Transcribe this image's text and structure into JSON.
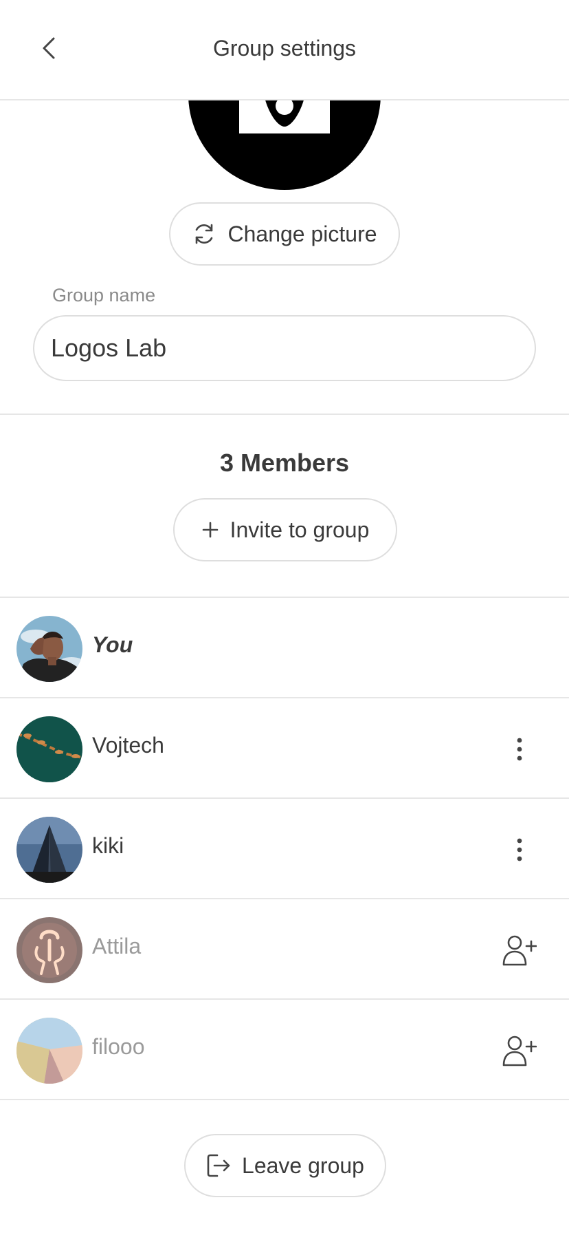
{
  "header": {
    "title": "Group settings",
    "back_icon": "chevron-left-icon"
  },
  "picture": {
    "change_label": "Change picture",
    "change_icon": "refresh-icon"
  },
  "group_name": {
    "label": "Group name",
    "value": "Logos Lab"
  },
  "members": {
    "title": "3 Members",
    "invite_label": "Invite to group",
    "invite_icon": "plus-icon",
    "list": [
      {
        "name": "You",
        "action": "none"
      },
      {
        "name": "Vojtech",
        "action": "more-vertical-icon"
      },
      {
        "name": "kiki",
        "action": "more-vertical-icon"
      },
      {
        "name": "Attila",
        "action": "add-user-icon"
      },
      {
        "name": "filooo",
        "action": "add-user-icon"
      }
    ]
  },
  "leave": {
    "label": "Leave group",
    "icon": "exit-icon"
  },
  "colors": {
    "text": "#3a3a3a",
    "muted": "#9a9a9a",
    "border": "#dedede",
    "divider": "#e6e6e6"
  }
}
